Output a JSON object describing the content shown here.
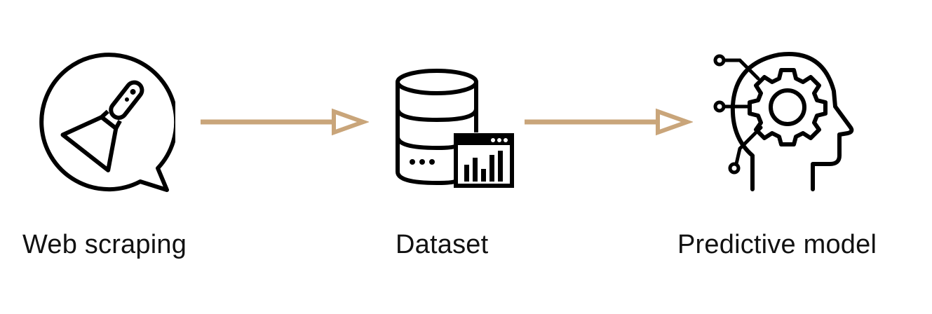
{
  "diagram": {
    "steps": [
      {
        "label": "Web scraping",
        "icon": "scraper-speech-bubble-icon"
      },
      {
        "label": "Dataset",
        "icon": "database-chart-icon"
      },
      {
        "label": "Predictive model",
        "icon": "ai-head-gear-icon"
      }
    ],
    "arrow_color": "#C9A57A",
    "icon_color": "#000000"
  }
}
